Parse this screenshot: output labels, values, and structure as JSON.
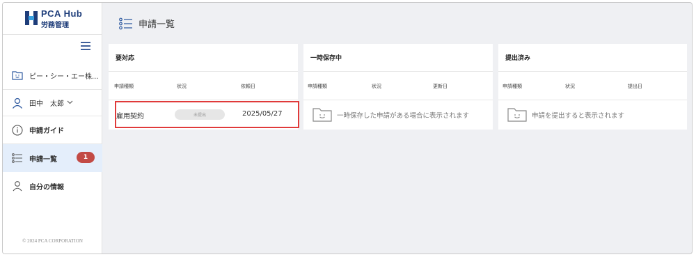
{
  "brand": {
    "title": "PCA Hub",
    "subtitle": "労務管理"
  },
  "sidebar": {
    "company_name": "ピー・シー・エー株...",
    "user_name": "田中　太郎",
    "nav": [
      {
        "label": "申請ガイド",
        "icon": "info-icon"
      },
      {
        "label": "申請一覧",
        "icon": "list-icon",
        "badge": "1"
      },
      {
        "label": "自分の情報",
        "icon": "person-icon"
      }
    ],
    "copyright": "© 2024 PCA CORPORATION"
  },
  "page": {
    "title": "申請一覧"
  },
  "panels": {
    "pending": {
      "title": "要対応",
      "columns": [
        "申請種類",
        "状況",
        "依頼日"
      ],
      "rows": [
        {
          "type": "雇用契約",
          "status": "未提出",
          "date": "2025/05/27"
        }
      ]
    },
    "draft": {
      "title": "一時保存中",
      "columns": [
        "申請種類",
        "状況",
        "更新日"
      ],
      "empty_text": "一時保存した申請がある場合に表示されます"
    },
    "submitted": {
      "title": "提出済み",
      "columns": [
        "申請種類",
        "状況",
        "提出日"
      ],
      "empty_text": "申請を提出すると表示されます"
    }
  },
  "colors": {
    "accent": "#2f5aa0",
    "badge": "#c24a45",
    "active_nav": "#e4eefb",
    "highlight": "#e03a3a"
  }
}
